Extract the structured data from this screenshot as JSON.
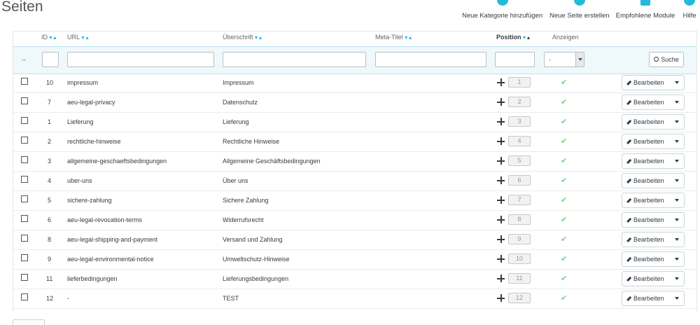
{
  "page": {
    "title": "Seiten"
  },
  "toolbar": {
    "new_category": "Neue Kategorie hinzufügen",
    "new_page": "Neue Seite erstellen",
    "recommended_modules": "Empfohlene Module",
    "help": "Hilfe"
  },
  "table": {
    "columns": {
      "id": "ID",
      "url": "URL",
      "heading": "Überschrift",
      "meta_title": "Meta-Titel",
      "position": "Position",
      "display": "Anzeigen"
    },
    "filter": {
      "dash": "--",
      "select_value": "-",
      "search_label": "Suche"
    },
    "edit_label": "Bearbeiten",
    "rows": [
      {
        "id": "10",
        "url": "impressum",
        "heading": "Impressum",
        "position": "1"
      },
      {
        "id": "7",
        "url": "aeu-legal-privacy",
        "heading": "Datenschutz",
        "position": "2"
      },
      {
        "id": "1",
        "url": "Lieferung",
        "heading": "Lieferung",
        "position": "3"
      },
      {
        "id": "2",
        "url": "rechtliche-hinweise",
        "heading": "Rechtliche Hinweise",
        "position": "4"
      },
      {
        "id": "3",
        "url": "allgemeine-geschaeftsbedingungen",
        "heading": "Allgemeine Geschäftsbedingungen",
        "position": "5"
      },
      {
        "id": "4",
        "url": "uber-uns",
        "heading": "Über uns",
        "position": "6"
      },
      {
        "id": "5",
        "url": "sichere-zahlung",
        "heading": "Sichere Zahlung",
        "position": "7"
      },
      {
        "id": "6",
        "url": "aeu-legal-revocation-terms",
        "heading": "Widerrufsrecht",
        "position": "8"
      },
      {
        "id": "8",
        "url": "aeu-legal-shipping-and-payment",
        "heading": "Versand und Zahlung",
        "position": "9"
      },
      {
        "id": "9",
        "url": "aeu-legal-environmental-notice",
        "heading": "Umweltschutz-Hinweise",
        "position": "10"
      },
      {
        "id": "11",
        "url": "lieferbedingungen",
        "heading": "Lieferungsbedingungen",
        "position": "11"
      },
      {
        "id": "12",
        "url": "-",
        "heading": "TEST",
        "position": "12"
      }
    ]
  },
  "colors": {
    "accent": "#25b9d7",
    "active": "#78d07d",
    "text": "#363a41"
  },
  "icons": {
    "sort": "sort-arrows-icon",
    "move": "move-icon",
    "check": "check-icon",
    "edit": "pencil-icon",
    "search": "search-icon"
  }
}
